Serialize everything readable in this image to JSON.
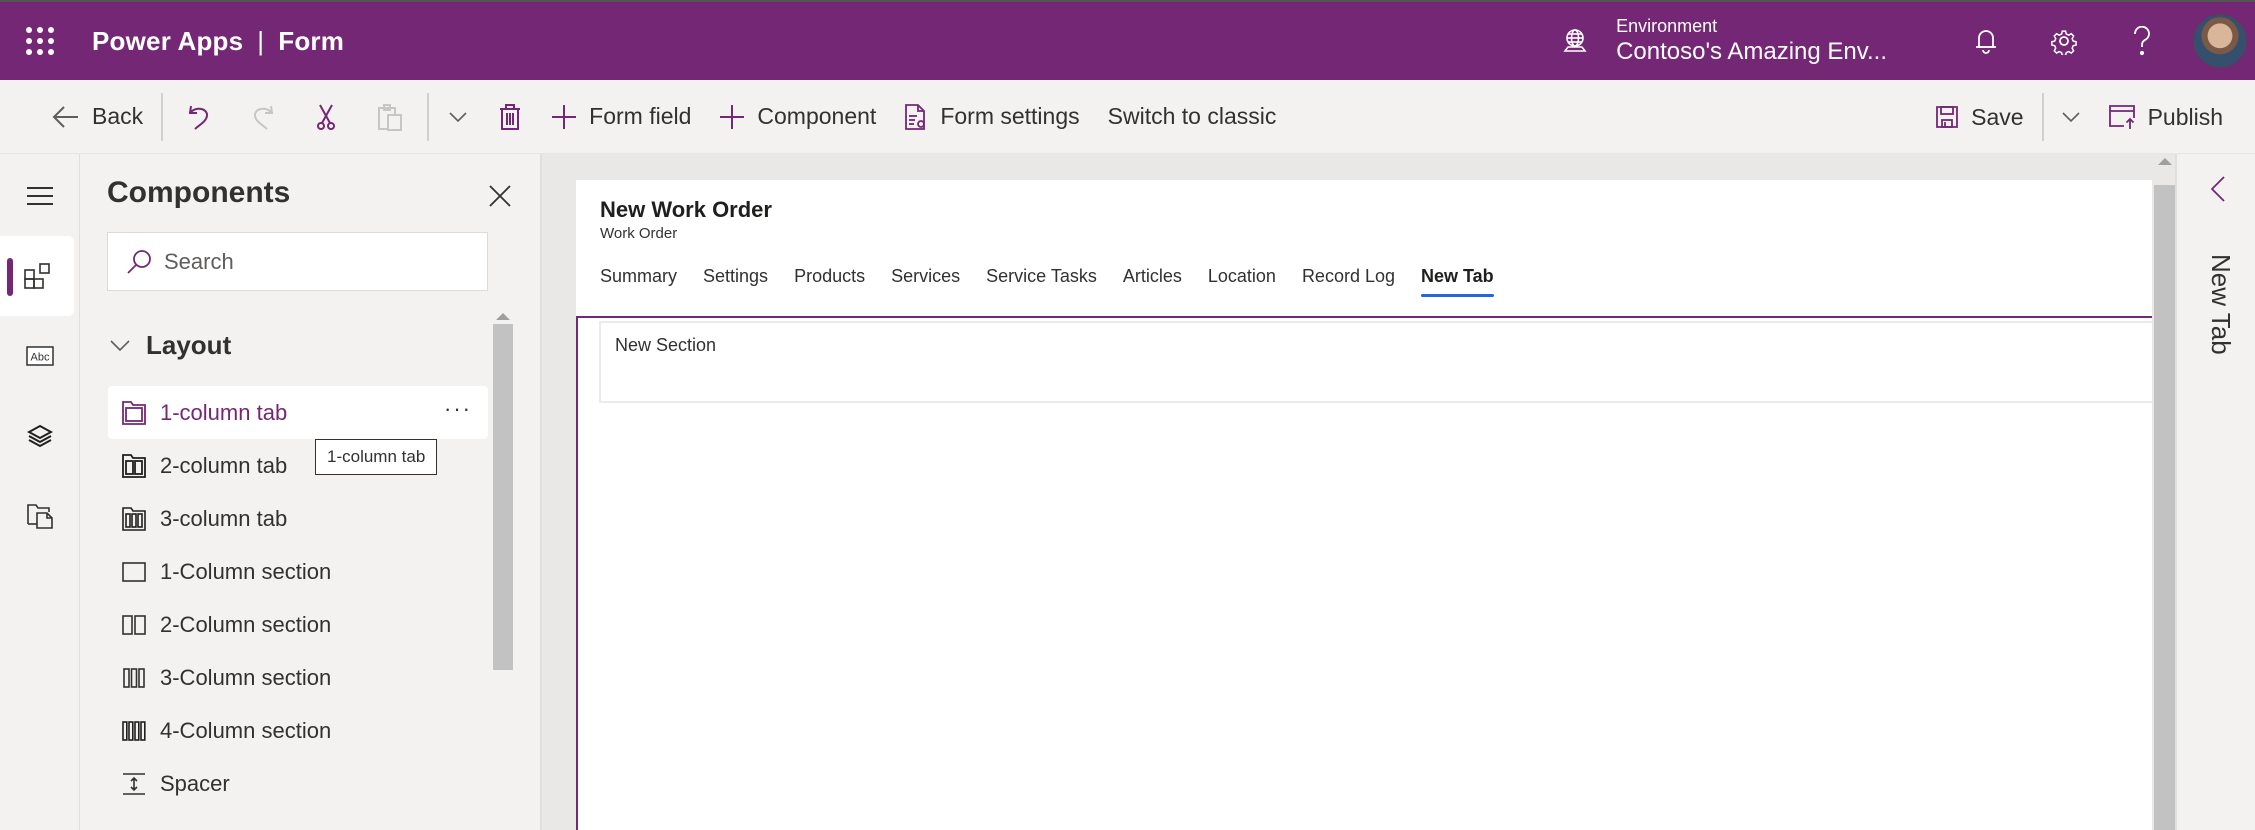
{
  "header": {
    "product": "Power Apps",
    "page": "Form",
    "separator": "|",
    "environment_label": "Environment",
    "environment_name": "Contoso's Amazing Env...",
    "icons": [
      "waffle-icon",
      "environment-globe-icon",
      "bell-icon",
      "gear-icon",
      "help-icon",
      "avatar"
    ]
  },
  "commandbar": {
    "back": "Back",
    "form_field": "Form field",
    "component": "Component",
    "form_settings": "Form settings",
    "switch_classic": "Switch to classic",
    "save": "Save",
    "publish": "Publish"
  },
  "rail": {
    "items": [
      "hamburger-menu",
      "components",
      "table-columns",
      "tree-view",
      "form-libraries"
    ],
    "active": "components"
  },
  "panel": {
    "title": "Components",
    "search_placeholder": "Search",
    "group": "Layout",
    "items": [
      {
        "label": "1-column tab",
        "icon": "one-column-tab-icon"
      },
      {
        "label": "2-column tab",
        "icon": "two-column-tab-icon"
      },
      {
        "label": "3-column tab",
        "icon": "three-column-tab-icon"
      },
      {
        "label": "1-Column section",
        "icon": "one-column-section-icon"
      },
      {
        "label": "2-Column section",
        "icon": "two-column-section-icon"
      },
      {
        "label": "3-Column section",
        "icon": "three-column-section-icon"
      },
      {
        "label": "4-Column section",
        "icon": "four-column-section-icon"
      },
      {
        "label": "Spacer",
        "icon": "spacer-icon"
      }
    ],
    "more": "···",
    "tooltip": "1-column tab"
  },
  "form": {
    "title": "New Work Order",
    "subtitle": "Work Order",
    "tabs": [
      "Summary",
      "Settings",
      "Products",
      "Services",
      "Service Tasks",
      "Articles",
      "Location",
      "Record Log",
      "New Tab"
    ],
    "active_tab": "New Tab",
    "section_title": "New Section"
  },
  "right_panel": {
    "label": "New Tab"
  },
  "colors": {
    "brand": "#742774",
    "tab_underline": "#2266e3",
    "background": "#f3f2f1"
  }
}
